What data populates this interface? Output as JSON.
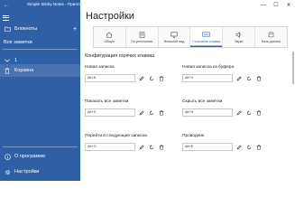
{
  "window": {
    "title": "Simple Sticky Notes - Приложение",
    "controls": {
      "minimize": "—",
      "maximize": "☐",
      "close": "✕"
    }
  },
  "sidebar": {
    "notebooks_label": "Блокноты",
    "notebooks_add": "+",
    "all_notes_label": "Все заметки",
    "group1_label": "1",
    "trash_label": "Корзина",
    "about_label": "О программе",
    "settings_label": "Настройки"
  },
  "main": {
    "title": "Настройки",
    "tabs": [
      {
        "label": "Общее",
        "icon": "home-icon",
        "active": false
      },
      {
        "label": "По умолчанию",
        "icon": "note-icon",
        "active": false
      },
      {
        "label": "Внешний вид",
        "icon": "monitor-icon",
        "active": false
      },
      {
        "label": "Сочетания клавиш",
        "icon": "keyboard-icon",
        "active": true
      },
      {
        "label": "Звуки",
        "icon": "speaker-icon",
        "active": false
      },
      {
        "label": "База данных",
        "icon": "database-icon",
        "active": false
      }
    ],
    "section_title": "Конфигурация горячих клавиш",
    "hotkeys": [
      {
        "label": "Новая записка",
        "value": "Alt+N"
      },
      {
        "label": "Новая записка из буфера",
        "value": "Alt+V"
      },
      {
        "label": "Показать все заметки",
        "value": "Alt+S"
      },
      {
        "label": "Скрыть все заметки",
        "value": "Alt+H"
      },
      {
        "label": "Перейти в следующие записка",
        "value": "Alt+G"
      },
      {
        "label": "Проводник",
        "value": "Alt+E"
      }
    ]
  },
  "colors": {
    "sidebar_bg": "#2f5fa5",
    "accent": "#2f5fa5"
  }
}
